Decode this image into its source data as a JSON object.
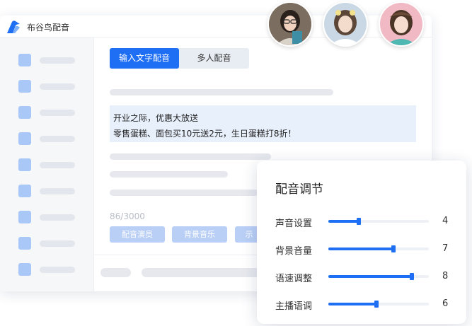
{
  "app": {
    "title": "布谷鸟配音"
  },
  "tabs": [
    {
      "label": "输入文字配音",
      "active": true
    },
    {
      "label": "多人配音",
      "active": false
    }
  ],
  "editor": {
    "lines": [
      "开业之际，优惠大放送",
      "零售蛋糕、面包买10元送2元，生日蛋糕打8折！"
    ],
    "counter": "86/3000"
  },
  "chips": [
    "配音演员",
    "背景音乐",
    "示"
  ],
  "panel": {
    "title": "配音调节",
    "rows": [
      {
        "label": "声音设置",
        "value": "4",
        "level": 0.3
      },
      {
        "label": "背景音量",
        "value": "7",
        "level": 0.65
      },
      {
        "label": "语速调整",
        "value": "8",
        "level": 0.83
      },
      {
        "label": "主播语调",
        "value": "6",
        "level": 0.48
      }
    ]
  },
  "colors": {
    "accent": "#1f6ff5",
    "chip": "#b9cff6",
    "sidebar_icon": "#a9c8f7"
  },
  "icons": {
    "logo": "cuckoo-bird-logo-icon"
  }
}
